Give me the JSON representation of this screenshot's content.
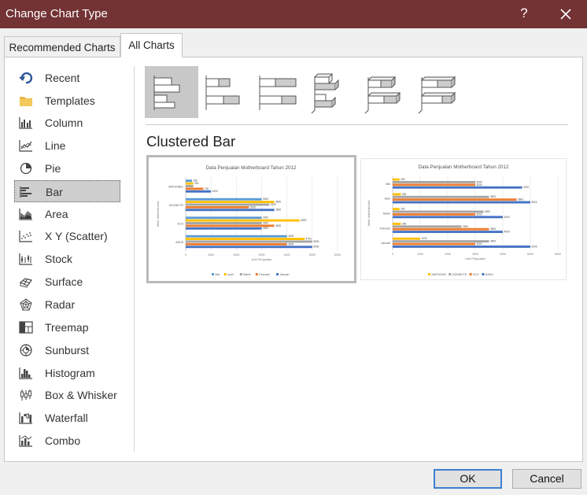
{
  "window": {
    "title": "Change Chart Type",
    "help_label": "?"
  },
  "tabs": [
    {
      "label": "Recommended Charts"
    },
    {
      "label": "All Charts"
    }
  ],
  "sidebar": {
    "items": [
      {
        "label": "Recent",
        "icon": "recent-icon"
      },
      {
        "label": "Templates",
        "icon": "folder-icon"
      },
      {
        "label": "Column",
        "icon": "column-chart-icon"
      },
      {
        "label": "Line",
        "icon": "line-chart-icon"
      },
      {
        "label": "Pie",
        "icon": "pie-chart-icon"
      },
      {
        "label": "Bar",
        "icon": "bar-chart-icon",
        "selected": true
      },
      {
        "label": "Area",
        "icon": "area-chart-icon"
      },
      {
        "label": "X Y (Scatter)",
        "icon": "scatter-chart-icon"
      },
      {
        "label": "Stock",
        "icon": "stock-chart-icon"
      },
      {
        "label": "Surface",
        "icon": "surface-chart-icon"
      },
      {
        "label": "Radar",
        "icon": "radar-chart-icon"
      },
      {
        "label": "Treemap",
        "icon": "treemap-chart-icon"
      },
      {
        "label": "Sunburst",
        "icon": "sunburst-chart-icon"
      },
      {
        "label": "Histogram",
        "icon": "histogram-chart-icon"
      },
      {
        "label": "Box & Whisker",
        "icon": "box-whisker-chart-icon"
      },
      {
        "label": "Waterfall",
        "icon": "waterfall-chart-icon"
      },
      {
        "label": "Combo",
        "icon": "combo-chart-icon"
      }
    ]
  },
  "subtype_title": "Clustered Bar",
  "colors": {
    "titlebar": "#733234",
    "blue": "#4472c4",
    "orange": "#ed7d31",
    "gray": "#a5a5a5",
    "gold": "#ffc000",
    "lightblue": "#5b9bd5"
  },
  "chart_data": [
    {
      "type": "bar",
      "title": "Data Penjualan Motherboard Tahun 2012",
      "xlabel": "Unit Penjualan",
      "ylabel": "Merk Motherboard",
      "categories": [
        "MATSONIC",
        "GIGABYTE",
        "ECS",
        "ASUS"
      ],
      "xlim": [
        0,
        6000
      ],
      "x_ticks": [
        "0",
        "1000",
        "2000",
        "3000",
        "4000",
        "5000",
        "6000"
      ],
      "series": [
        {
          "name": "Mei",
          "values": [
            250,
            3000,
            3000,
            4000
          ],
          "labels": [
            "250",
            "3000",
            "3000",
            "4000"
          ]
        },
        {
          "name": "April",
          "values": [
            300,
            3500,
            4500,
            4700
          ],
          "labels": [
            "300",
            "3500",
            "4500",
            "4700"
          ]
        },
        {
          "name": "Maret",
          "values": [
            300,
            3300,
            3000,
            5000
          ],
          "labels": [
            "",
            "3300",
            "3000",
            "5000"
          ]
        },
        {
          "name": "Februari",
          "values": [
            700,
            2500,
            3500,
            4000
          ],
          "labels": [
            "700",
            "2500",
            "3500",
            "4000"
          ]
        },
        {
          "name": "Januari",
          "values": [
            1000,
            3500,
            3000,
            5000
          ],
          "labels": [
            "1000",
            "3500",
            "3000",
            "5000"
          ]
        }
      ],
      "legend": "bottom"
    },
    {
      "type": "bar",
      "title": "Data Penjualan Motherboard Tahun 2012",
      "xlabel": "Unit Penjualan",
      "ylabel": "Merk Motherboard",
      "categories": [
        "Mei",
        "April",
        "Maret",
        "Februari",
        "Januari"
      ],
      "xlim": [
        0,
        6000
      ],
      "x_ticks": [
        "0",
        "1000",
        "2000",
        "3000",
        "4000",
        "5000",
        "6000"
      ],
      "series": [
        {
          "name": "MATSONIC",
          "values": [
            250,
            300,
            250,
            300,
            1000
          ],
          "labels": [
            "250",
            "300",
            "250",
            "300",
            "1000"
          ]
        },
        {
          "name": "GIGABYTE",
          "values": [
            3000,
            3500,
            3300,
            2500,
            3500
          ],
          "labels": [
            "3000",
            "3500",
            "3300",
            "2500",
            "3500"
          ]
        },
        {
          "name": "ECS",
          "values": [
            3000,
            4500,
            3000,
            3500,
            3000
          ],
          "labels": [
            "3000",
            "4500",
            "3000",
            "3500",
            "3000"
          ]
        },
        {
          "name": "ASUS",
          "values": [
            4700,
            5000,
            4000,
            4000,
            5000
          ],
          "labels": [
            "4700",
            "5000",
            "4000",
            "4000",
            "5000"
          ]
        }
      ],
      "legend": "bottom"
    }
  ],
  "buttons": {
    "ok": "OK",
    "cancel": "Cancel"
  }
}
